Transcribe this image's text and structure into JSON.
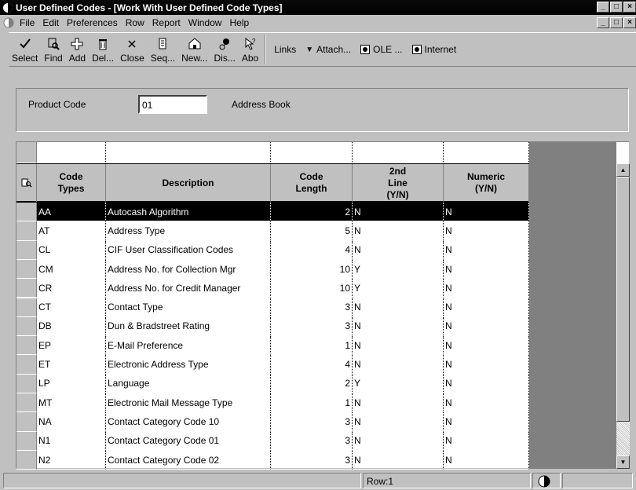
{
  "window": {
    "title": "User Defined Codes - [Work With User Defined Code Types]",
    "minimize": "_",
    "maximize": "□",
    "close": "×"
  },
  "menu": {
    "items": [
      "File",
      "Edit",
      "Preferences",
      "Row",
      "Report",
      "Window",
      "Help"
    ]
  },
  "toolbar": {
    "buttons": [
      {
        "label": "Select",
        "icon": "checkmark-icon"
      },
      {
        "label": "Find",
        "icon": "find-icon"
      },
      {
        "label": "Add",
        "icon": "add-icon"
      },
      {
        "label": "Del...",
        "icon": "trash-icon"
      },
      {
        "label": "Close",
        "icon": "close-icon"
      },
      {
        "label": "Seq...",
        "icon": "sequence-icon"
      },
      {
        "label": "New...",
        "icon": "new-icon"
      },
      {
        "label": "Dis...",
        "icon": "display-icon"
      },
      {
        "label": "Abo",
        "icon": "about-icon"
      }
    ],
    "links": "Links",
    "attach": "Attach...",
    "ole": "OLE ...",
    "internet": "Internet"
  },
  "form": {
    "product_code_label": "Product Code",
    "product_code_value": "01",
    "product_code_desc": "Address Book"
  },
  "grid": {
    "columns": [
      {
        "label": "Code Types"
      },
      {
        "label": "Description"
      },
      {
        "label": "Code Length"
      },
      {
        "label": "2nd Line (Y/N)"
      },
      {
        "label": "Numeric (Y/N)"
      }
    ],
    "rows": [
      {
        "type": "AA",
        "desc": "Autocash Algorithm",
        "len": "2",
        "second": "N",
        "numeric": "N"
      },
      {
        "type": "AT",
        "desc": "Address Type",
        "len": "5",
        "second": "N",
        "numeric": "N"
      },
      {
        "type": "CL",
        "desc": "CIF User Classification Codes",
        "len": "4",
        "second": "N",
        "numeric": "N"
      },
      {
        "type": "CM",
        "desc": "Address No. for Collection Mgr",
        "len": "10",
        "second": "Y",
        "numeric": "N"
      },
      {
        "type": "CR",
        "desc": "Address No. for Credit Manager",
        "len": "10",
        "second": "Y",
        "numeric": "N"
      },
      {
        "type": "CT",
        "desc": "Contact Type",
        "len": "3",
        "second": "N",
        "numeric": "N"
      },
      {
        "type": "DB",
        "desc": "Dun & Bradstreet Rating",
        "len": "3",
        "second": "N",
        "numeric": "N"
      },
      {
        "type": "EP",
        "desc": "E-Mail Preference",
        "len": "1",
        "second": "N",
        "numeric": "N"
      },
      {
        "type": "ET",
        "desc": "Electronic Address Type",
        "len": "4",
        "second": "N",
        "numeric": "N"
      },
      {
        "type": "LP",
        "desc": "Language",
        "len": "2",
        "second": "Y",
        "numeric": "N"
      },
      {
        "type": "MT",
        "desc": "Electronic Mail Message Type",
        "len": "1",
        "second": "N",
        "numeric": "N"
      },
      {
        "type": "NA",
        "desc": "Contact Category Code 10",
        "len": "3",
        "second": "N",
        "numeric": "N"
      },
      {
        "type": "N1",
        "desc": "Contact Category Code 01",
        "len": "3",
        "second": "N",
        "numeric": "N"
      },
      {
        "type": "N2",
        "desc": "Contact Category Code 02",
        "len": "3",
        "second": "N",
        "numeric": "N"
      }
    ]
  },
  "status": {
    "row": "Row:1"
  }
}
